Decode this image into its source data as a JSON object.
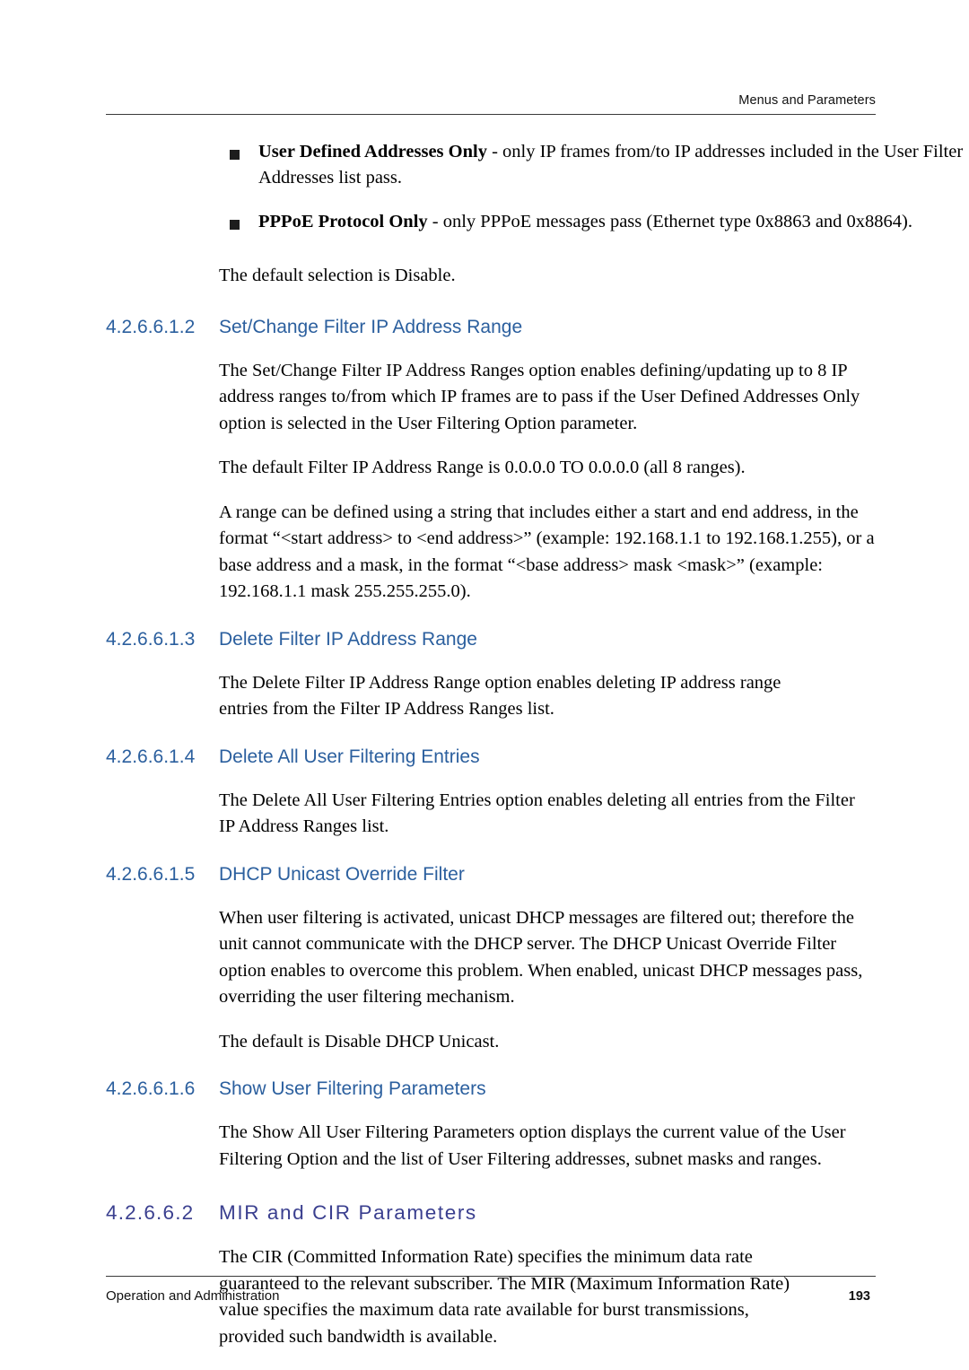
{
  "header": {
    "running_title": "Menus and Parameters"
  },
  "bullets": [
    {
      "bold": "User Defined Addresses Only",
      "rest": " - only IP frames from/to IP addresses included in the User Filter Addresses list pass."
    },
    {
      "bold": "PPPoE Protocol Only",
      "rest": " - only PPPoE messages pass (Ethernet type 0x8863 and 0x8864)."
    }
  ],
  "intro": {
    "default_selection": "The default selection is Disable."
  },
  "sections": [
    {
      "number": "4.2.6.6.1.2",
      "title": "Set/Change Filter IP Address Range",
      "paragraphs": [
        "The Set/Change Filter IP Address Ranges option enables defining/updating up to 8 IP address ranges to/from which IP frames are to pass if the User Defined Addresses Only option is selected in the User Filtering Option parameter.",
        "The default Filter IP Address Range is 0.0.0.0 TO 0.0.0.0 (all 8 ranges).",
        "A range can be defined using a string that includes either a start and end address, in the format “<start address> to <end address>” (example: 192.168.1.1 to 192.168.1.255), or a base address and a mask, in the format “<base address> mask <mask>” (example: 192.168.1.1 mask 255.255.255.0)."
      ]
    },
    {
      "number": "4.2.6.6.1.3",
      "title": "Delete Filter IP Address Range",
      "paragraphs": [
        "The Delete Filter IP Address Range option enables deleting IP address range entries from the Filter IP Address Ranges list."
      ]
    },
    {
      "number": "4.2.6.6.1.4",
      "title": "Delete All User Filtering Entries",
      "paragraphs": [
        "The Delete All User Filtering Entries option enables deleting all entries from the Filter IP Address Ranges list."
      ]
    },
    {
      "number": "4.2.6.6.1.5",
      "title": "DHCP Unicast Override Filter",
      "paragraphs": [
        "When user filtering is activated, unicast DHCP messages are filtered out; therefore the unit cannot communicate with the DHCP server. The DHCP Unicast Override Filter option enables to overcome this problem. When enabled, unicast DHCP messages pass, overriding the user filtering mechanism.",
        "The default is Disable DHCP Unicast."
      ]
    },
    {
      "number": "4.2.6.6.1.6",
      "title": "Show User Filtering Parameters",
      "paragraphs": [
        "The Show All User Filtering Parameters option displays the current value of the User Filtering Option and the list of User Filtering addresses, subnet masks and ranges."
      ]
    }
  ],
  "section_major": {
    "number": "4.2.6.6.2",
    "title": "MIR and CIR Parameters",
    "paragraphs": [
      "The CIR (Committed Information Rate) specifies the minimum data rate guaranteed to the relevant subscriber. The MIR (Maximum Information Rate) value specifies the maximum data rate available for burst transmissions, provided such bandwidth is available."
    ]
  },
  "footer": {
    "left": "Operation and Administration",
    "page_number": "193"
  },
  "colors": {
    "subheading": "#2b5f9e",
    "heading": "#3a3f8f",
    "rule": "#3a3a3a"
  }
}
